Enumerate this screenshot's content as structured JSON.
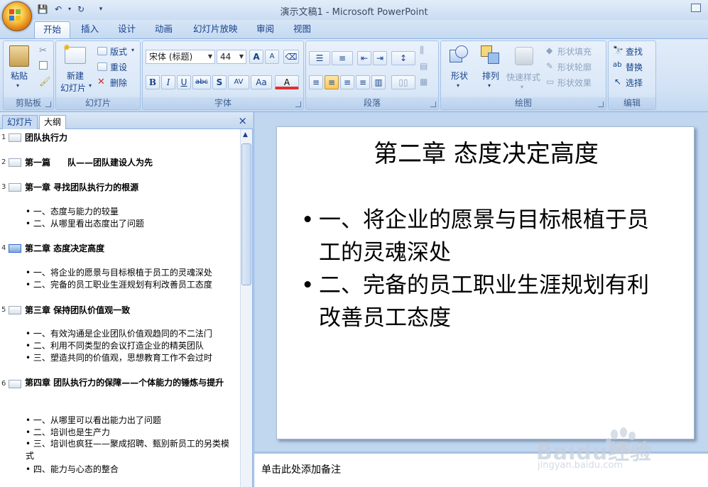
{
  "app": {
    "title": "演示文稿1 - Microsoft PowerPoint"
  },
  "tabs": [
    "开始",
    "插入",
    "设计",
    "动画",
    "幻灯片放映",
    "审阅",
    "视图"
  ],
  "active_tab": "开始",
  "ribbon": {
    "clipboard": {
      "label": "剪贴板",
      "paste": "粘贴"
    },
    "slides": {
      "label": "幻灯片",
      "new_slide_line1": "新建",
      "new_slide_line2": "幻灯片",
      "layout": "版式",
      "reset": "重设",
      "delete": "删除"
    },
    "font": {
      "label": "字体",
      "font_name": "宋体 (标题)",
      "font_size": "44",
      "bold": "B",
      "italic": "I",
      "underline": "U",
      "strike": "abc",
      "shadow": "S",
      "spacing": "AV",
      "case": "Aa",
      "color": "A",
      "grow": "A",
      "shrink": "A"
    },
    "paragraph": {
      "label": "段落"
    },
    "drawing": {
      "label": "绘图",
      "shapes": "形状",
      "arrange": "排列",
      "quick_styles": "快速样式",
      "fill": "形状填充",
      "outline": "形状轮廓",
      "effects": "形状效果"
    },
    "editing": {
      "label": "编辑",
      "find": "查找",
      "replace": "替换",
      "select": "选择"
    }
  },
  "left_pane": {
    "tab_slides": "幻灯片",
    "tab_outline": "大纲",
    "close": "×",
    "outline": [
      {
        "num": "1",
        "title": "团队执行力",
        "bullets": []
      },
      {
        "num": "2",
        "title": "第一篇　　队——团队建设人为先",
        "bullets": []
      },
      {
        "num": "3",
        "title": "第一章 寻找团队执行力的根源",
        "bullets": [
          "一、态度与能力的较量",
          "二、从哪里看出态度出了问题"
        ]
      },
      {
        "num": "4",
        "title": "第二章 态度决定高度",
        "bullets": [
          "一、将企业的愿景与目标根植于员工的灵魂深处",
          "二、完备的员工职业生涯规划有利改善员工态度"
        ]
      },
      {
        "num": "5",
        "title": "第三章 保持团队价值观一致",
        "bullets": [
          "一、有效沟通是企业团队价值观趋同的不二法门",
          "二、利用不同类型的会议打造企业的精英团队",
          "三、塑造共同的价值观，思想教育工作不会过时"
        ]
      },
      {
        "num": "6",
        "title": "第四章 团队执行力的保障——个体能力的锤炼与提升",
        "bullets": [
          "一、从哪里可以看出能力出了问题",
          "二、培训也是生产力",
          "三、培训也疯狂——聚成招聘、甄别新员工的另类模式",
          "四、能力与心态的整合"
        ]
      }
    ]
  },
  "slide": {
    "title": "第二章 态度决定高度",
    "bullets": [
      "一、将企业的愿景与目标根植于员工的灵魂深处",
      "二、完备的员工职业生涯规划有利改善员工态度"
    ]
  },
  "notes": {
    "placeholder": "单击此处添加备注"
  },
  "watermark": {
    "brand": "Baidu经验",
    "url": "jingyan.baidu.com"
  }
}
